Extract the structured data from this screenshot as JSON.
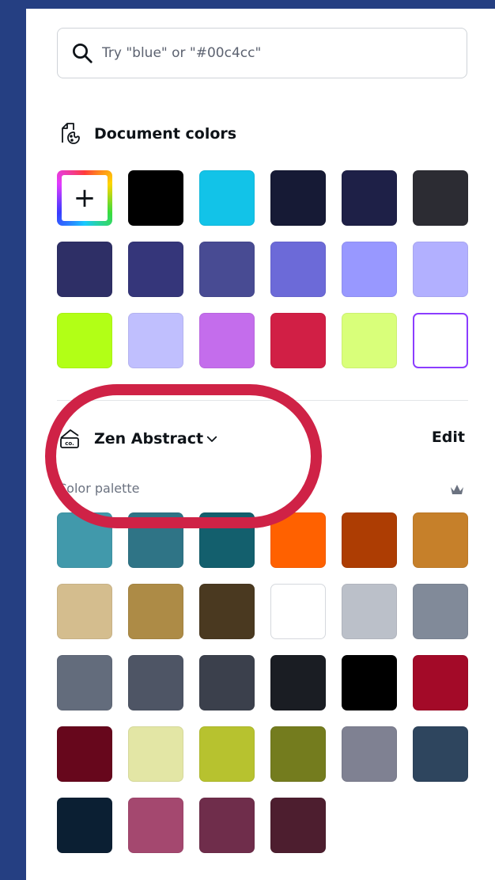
{
  "search": {
    "placeholder": "Try \"blue\" or \"#00c4cc\""
  },
  "document_colors": {
    "title": "Document colors",
    "add_button_label": "+",
    "swatches": [
      "#000000",
      "#12c3e8",
      "#161a35",
      "#1e2047",
      "#2c2c33",
      "#2e2f66",
      "#35367a",
      "#484b93",
      "#6c6ad8",
      "#9898ff",
      "#b2b0ff",
      "#b2ff16",
      "#c0bffe",
      "#c46dec",
      "#d11f45",
      "#d9ff7a",
      "#ffffff"
    ]
  },
  "brand_kit": {
    "name": "Zen Abstract",
    "edit_label": "Edit",
    "palette_label": "Color palette",
    "swatches": [
      "#4199ab",
      "#2f7486",
      "#135f6d",
      "#ff6100",
      "#ad3d03",
      "#c6802a",
      "#d4bd8e",
      "#ad8b46",
      "#4a3920",
      "#ffffff",
      "#bbc0c9",
      "#818a99",
      "#636c7c",
      "#4e5565",
      "#3b404c",
      "#1a1d23",
      "#000000",
      "#a30a28",
      "#67071c",
      "#e3e6a5",
      "#b7c22f",
      "#747c1e",
      "#7f8192",
      "#2e455e",
      "#0b1f33",
      "#a4486f",
      "#6f2d4b",
      "#4d1e2f"
    ]
  }
}
